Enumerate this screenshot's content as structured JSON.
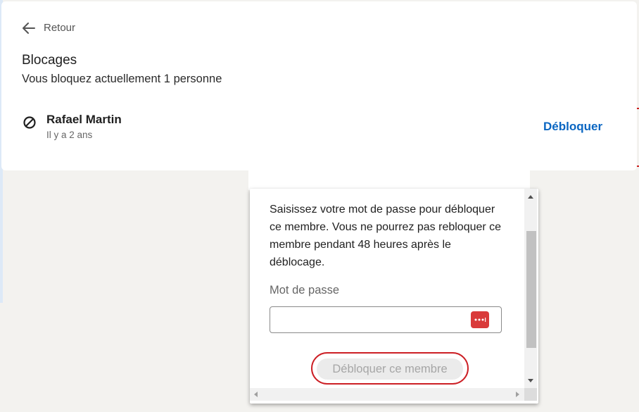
{
  "nav": {
    "back_label": "Retour"
  },
  "page": {
    "title": "Blocages",
    "subtitle": "Vous bloquez actuellement 1 personne"
  },
  "blocked_list": [
    {
      "name": "Rafael Martin",
      "time": "Il y a 2 ans",
      "action": "Débloquer",
      "icon": "block-icon"
    }
  ],
  "dialog": {
    "message": "Saisissez votre mot de passe pour débloquer ce membre. Vous ne pourrez pas rebloquer ce membre pendant 48 heures après le déblocage.",
    "password_label": "Mot de passe",
    "password_value": "",
    "password_manager_icon": "password-manager-icon",
    "submit_label": "Débloquer ce membre"
  },
  "colors": {
    "accent_link": "#0a66c2",
    "highlight": "#cc1f25",
    "password_manager": "#d93a3a",
    "disabled_button_bg": "#ebebeb"
  }
}
